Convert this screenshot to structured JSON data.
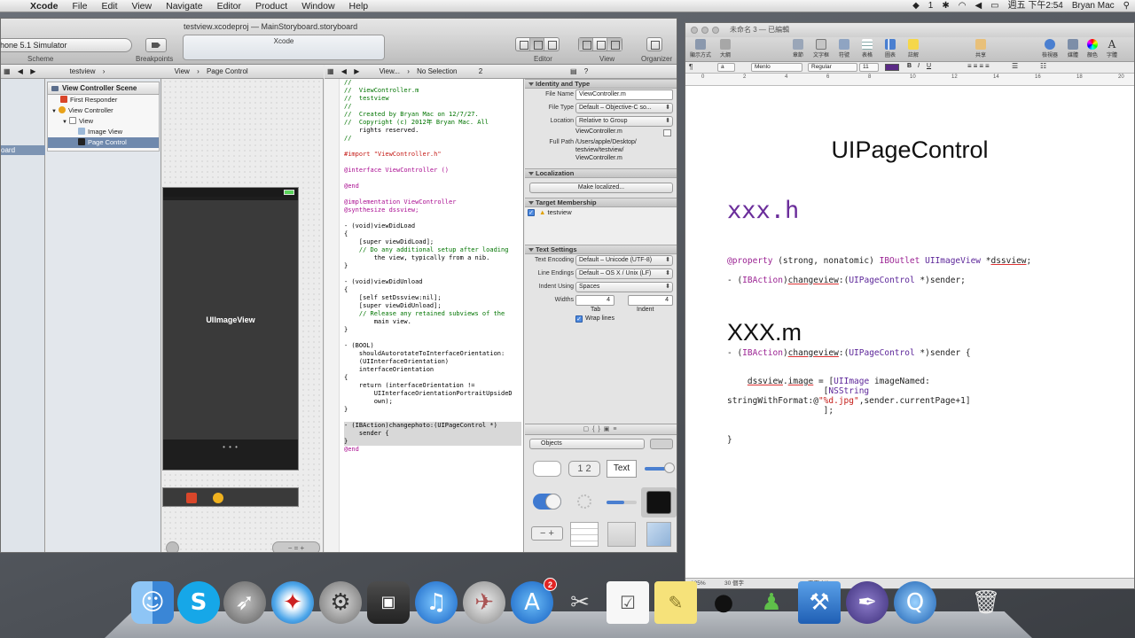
{
  "menubar": {
    "app_name": "Xcode",
    "menus": [
      "File",
      "Edit",
      "View",
      "Navigate",
      "Editor",
      "Product",
      "Window",
      "Help"
    ],
    "status": {
      "badge": "1",
      "clock": "週五 下午2:54",
      "user": "Bryan Mac"
    }
  },
  "xcode": {
    "title": "testview.xcodeproj — MainStoryboard.storyboard",
    "scheme": "hone 5.1 Simulator",
    "scheme_label": "Scheme",
    "breakpoints_label": "Breakpoints",
    "activity_text": "Xcode",
    "editor_label": "Editor",
    "view_label": "View",
    "organizer_label": "Organizer",
    "jumpbar_left": [
      "testview",
      "View",
      "Page Control"
    ],
    "jumpbar_right": [
      "View...",
      "No Selection",
      "2"
    ],
    "navigator_selected": "oard",
    "scene_header": "View Controller Scene",
    "outline": [
      {
        "label": "First Responder",
        "indent": 0
      },
      {
        "label": "View Controller",
        "indent": 0
      },
      {
        "label": "View",
        "indent": 1
      },
      {
        "label": "Image View",
        "indent": 2
      },
      {
        "label": "Page Control",
        "indent": 2
      }
    ],
    "canvas": {
      "image_view_label": "UIImageView",
      "page_dots": "• • •"
    },
    "code_lines": [
      "//",
      "//  ViewController.m",
      "//  testview",
      "//",
      "//  Created by Bryan Mac on 12/7/27.",
      "//  Copyright (c) 2012年 Bryan Mac. All",
      "    rights reserved.",
      "//",
      "",
      "#import \"ViewController.h\"",
      "",
      "@interface ViewController ()",
      "",
      "@end",
      "",
      "@implementation ViewController",
      "@synthesize dssview;",
      "",
      "- (void)viewDidLoad",
      "{",
      "    [super viewDidLoad];",
      "    // Do any additional setup after loading",
      "        the view, typically from a nib.",
      "}",
      "",
      "- (void)viewDidUnload",
      "{",
      "    [self setDssview:nil];",
      "    [super viewDidUnload];",
      "    // Release any retained subviews of the",
      "        main view.",
      "}",
      "",
      "- (BOOL)",
      "    shouldAutorotateToInterfaceOrientation:",
      "    (UIInterfaceOrientation)",
      "    interfaceOrientation",
      "{",
      "    return (interfaceOrientation !=",
      "        UIInterfaceOrientationPortraitUpsideD",
      "        own);",
      "}",
      "",
      "- (IBAction)changephoto:(UIPageControl *)",
      "    sender {",
      "}",
      "@end"
    ],
    "inspector": {
      "identity_header": "Identity and Type",
      "file_name_label": "File Name",
      "file_name": "ViewController.m",
      "file_type_label": "File Type",
      "file_type": "Default – Objective-C so...",
      "location_label": "Location",
      "location": "Relative to Group",
      "location_file": "ViewController.m",
      "full_path_label": "Full Path",
      "full_path": [
        "/Users/apple/Desktop/",
        "testview/testview/",
        "ViewController.m"
      ],
      "localization_header": "Localization",
      "make_localized": "Make localized...",
      "target_header": "Target Membership",
      "target_name": "testview",
      "text_settings_header": "Text Settings",
      "text_encoding_label": "Text Encoding",
      "text_encoding": "Default – Unicode (UTF-8)",
      "line_endings_label": "Line Endings",
      "line_endings": "Default – OS X / Unix (LF)",
      "indent_using_label": "Indent Using",
      "indent_using": "Spaces",
      "widths_label": "Widths",
      "tab_value": "4",
      "indent_value": "4",
      "tab_label": "Tab",
      "indent_label": "Indent",
      "wrap_lines": "Wrap lines",
      "library_filter": "Objects",
      "lib_text_label": "Text",
      "lib_stepper_label": "1 2"
    }
  },
  "textedit": {
    "title": "未命名 3 — 已編輯",
    "toolbar": [
      "顯示方式",
      "大綱",
      "章節",
      "文字框",
      "符號",
      "表格",
      "圖表",
      "註解",
      "共享",
      "檢視器",
      "媒體",
      "顏色",
      "字體"
    ],
    "format": {
      "style": "a",
      "font": "Menlo",
      "weight": "Regular",
      "size": "11"
    },
    "ruler_ticks": [
      "0",
      "2",
      "4",
      "6",
      "8",
      "10",
      "12",
      "14",
      "16",
      "18",
      "20"
    ],
    "doc": {
      "heading": "UIPageControl",
      "h_section": "xxx.h",
      "property_line": "@property (strong, nonatomic) IBOutlet UIImageView *dssview;",
      "action_decl": "- (IBAction)changeview:(UIPageControl *)sender;",
      "m_section": "XXX.m",
      "action_impl": "- (IBAction)changeview:(UIPageControl *)sender {",
      "body_1": "    dssview.image = [UIImage imageNamed:",
      "body_2": "                   [NSString",
      "body_3": "stringWithFormat:@\"%d.jpg\",sender.currentPage+1]",
      "body_4": "                   ];",
      "closing": "}"
    },
    "status": {
      "zoom": "125%",
      "word_count": "30 個字",
      "page": "頁面 1/1"
    }
  },
  "dock": {
    "items": [
      "finder",
      "skype",
      "launchpad",
      "safari",
      "system-preferences",
      "photo-booth",
      "itunes",
      "preview",
      "app-store",
      "cut",
      "reminders",
      "stickies",
      "qq",
      "msn",
      "xcode",
      "quill",
      "quicktime",
      "trash"
    ],
    "app_store_badge": "2"
  }
}
